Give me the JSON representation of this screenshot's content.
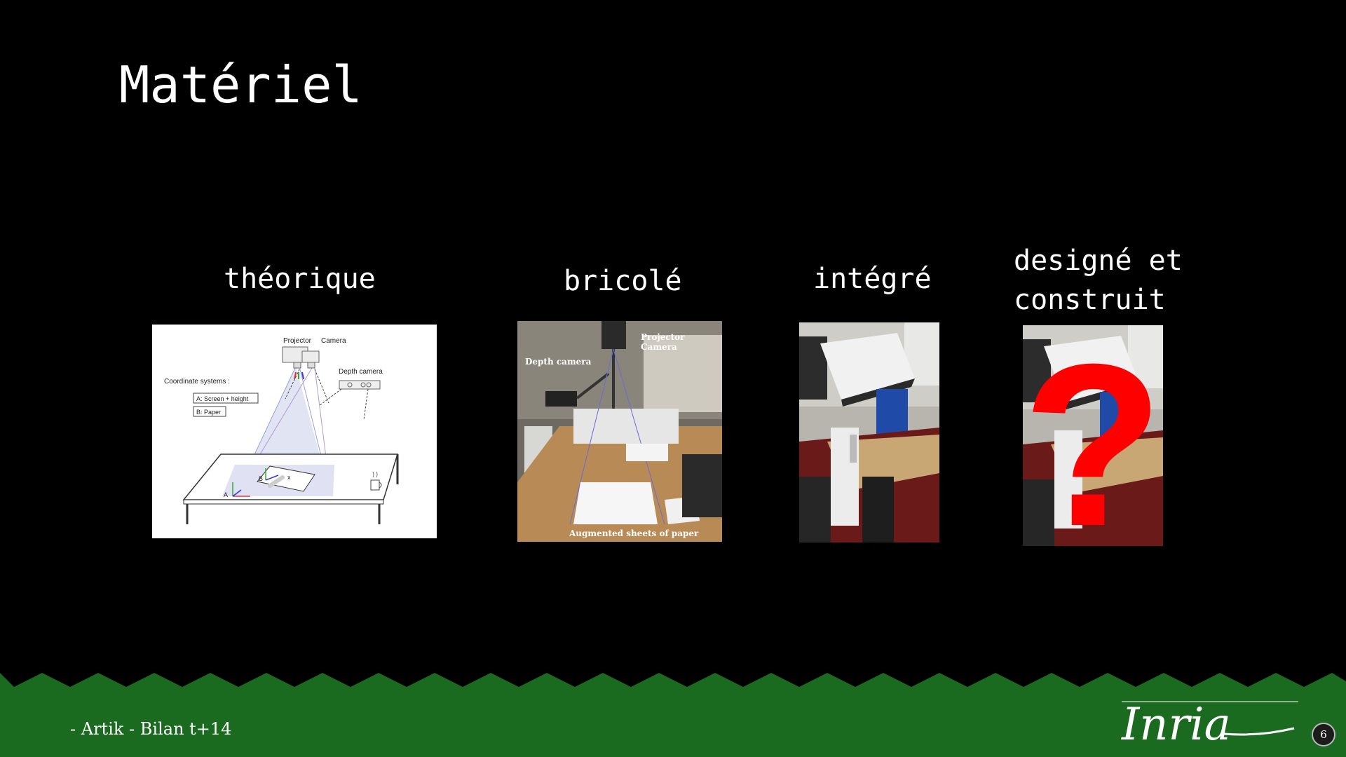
{
  "slide": {
    "title": "Matériel",
    "page_number": "6",
    "footer_text": "- Artik - Bilan t+14",
    "logo_text": "Inria"
  },
  "columns": [
    {
      "label": "théorique"
    },
    {
      "label": "bricolé"
    },
    {
      "label": "intégré"
    },
    {
      "label_line1": "designé et",
      "label_line2": "construit"
    }
  ],
  "diagram": {
    "projector": "Projector",
    "camera": "Camera",
    "depth_camera": "Depth camera",
    "coord_title": "Coordinate systems :",
    "coord_a": "A: Screen + height",
    "coord_b": "B: Paper",
    "axis_a": "A",
    "axis_b": "B",
    "axis_x": "x"
  },
  "photo_bricole": {
    "projector": "Projector",
    "camera": "Camera",
    "depth_camera": "Depth camera",
    "caption": "Augmented sheets of paper"
  },
  "question_mark": "?",
  "colors": {
    "background": "#000000",
    "footer_green": "#1a6b1f",
    "question_red": "#ff0000"
  }
}
